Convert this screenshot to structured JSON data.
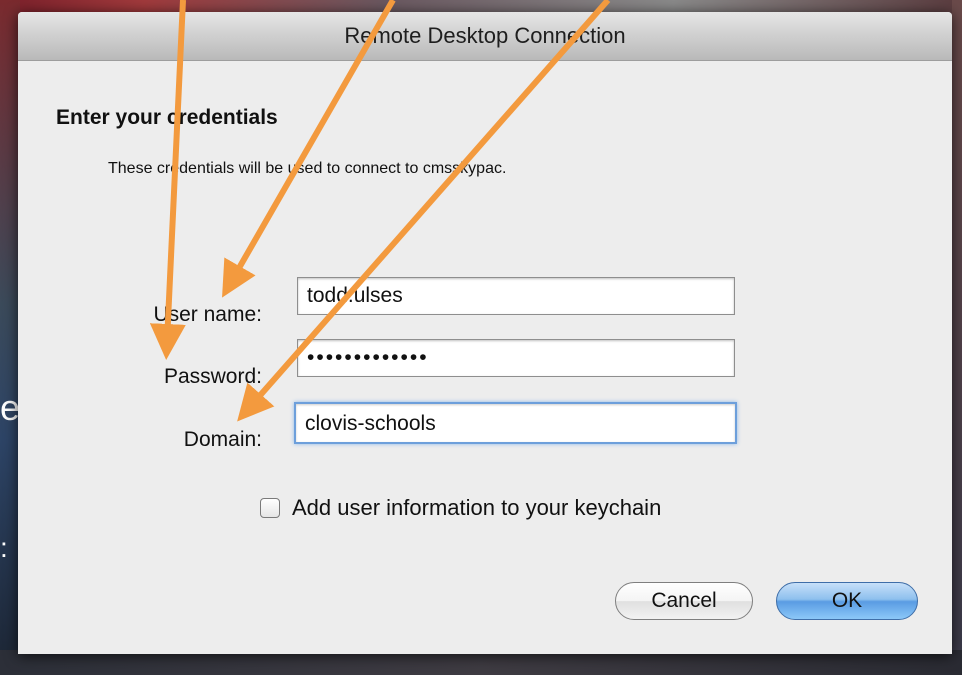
{
  "window": {
    "title": "Remote Desktop Connection"
  },
  "dialog": {
    "heading": "Enter your credentials",
    "subtext": "These credentials will be used to connect to cmsskypac."
  },
  "fields": {
    "user_name": {
      "label": "User name:",
      "value": "todd.ulses"
    },
    "password": {
      "label": "Password:",
      "value": "•••••••••••••"
    },
    "domain": {
      "label": "Domain:",
      "value": "clovis-schools"
    }
  },
  "checkbox": {
    "label": "Add user information to your keychain",
    "checked": false
  },
  "buttons": {
    "cancel": "Cancel",
    "ok": "OK"
  },
  "background": {
    "fragment_e": "e",
    "fragment_colon": ":"
  },
  "colors": {
    "annotation_arrow": "#f39a3e",
    "focus_ring": "#6d9fdb",
    "default_button": "#5a9ce3"
  }
}
